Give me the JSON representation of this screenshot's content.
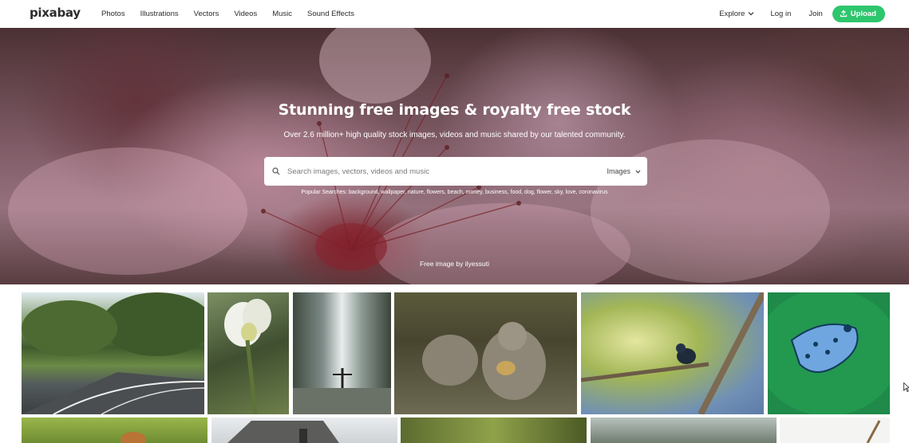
{
  "header": {
    "logo": "pixabay",
    "nav": [
      {
        "label": "Photos"
      },
      {
        "label": "Illustrations"
      },
      {
        "label": "Vectors"
      },
      {
        "label": "Videos"
      },
      {
        "label": "Music"
      },
      {
        "label": "Sound Effects"
      }
    ],
    "explore_label": "Explore",
    "login_label": "Log in",
    "join_label": "Join",
    "upload_label": "Upload"
  },
  "hero": {
    "title": "Stunning free images & royalty free stock",
    "subtitle": "Over 2.6 million+ high quality stock images, videos and music shared by our talented community.",
    "search_placeholder": "Search images, vectors, videos and music",
    "search_type": "Images",
    "popular_searches": "Popular Searches: background, wallpaper, nature, flowers, beach, money, business, food, dog, flower, sky, love, coronavirus",
    "credit": "Free image by ilyessuti"
  },
  "colors": {
    "accent": "#2ec66d",
    "text": "#2d2d2d"
  },
  "gallery": {
    "row1": [
      {
        "subject": "country road"
      },
      {
        "subject": "white daffodil"
      },
      {
        "subject": "waterfall"
      },
      {
        "subject": "monkeys"
      },
      {
        "subject": "bird on branch"
      },
      {
        "subject": "blue poison dart frog"
      }
    ],
    "row2": [
      {
        "subject": "dog in grass"
      },
      {
        "subject": "stone house"
      },
      {
        "subject": "green foliage"
      },
      {
        "subject": "misty forest"
      },
      {
        "subject": "sketch"
      }
    ]
  }
}
